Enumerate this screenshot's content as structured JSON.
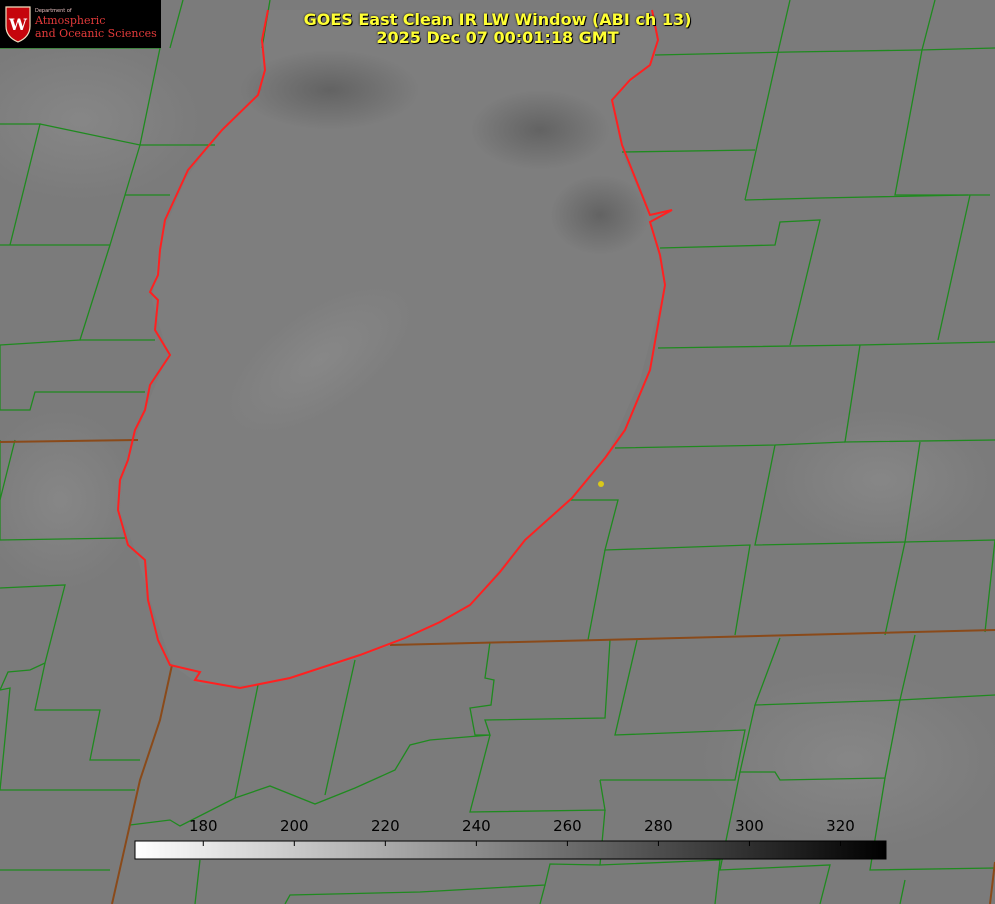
{
  "title": {
    "line1": "GOES East Clean IR LW Window (ABI ch 13)",
    "line2": "2025 Dec 07 00:01:18 GMT"
  },
  "logo": {
    "dept": "Department of",
    "line1": "Atmospheric",
    "line2": "and Oceanic Sciences",
    "emblem": "W"
  },
  "colorbar": {
    "ticks": [
      "180",
      "200",
      "220",
      "240",
      "260",
      "280",
      "300",
      "320"
    ],
    "min": 165,
    "max": 330,
    "gradient_start": "#ffffff",
    "gradient_end": "#000000"
  },
  "colors": {
    "county_lines": "#1f8a1f",
    "state_lines": "#8a4a1a",
    "lake_outline": "#ff2020",
    "title_text": "#ffff33",
    "marker": "#d9c81a"
  }
}
